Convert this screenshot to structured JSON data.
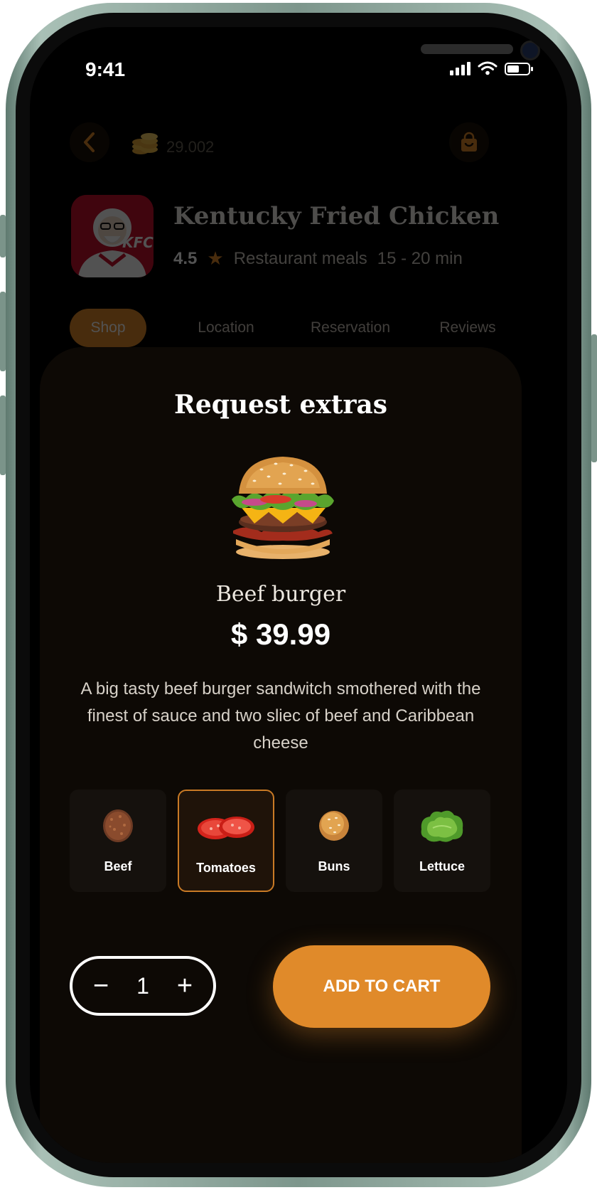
{
  "status_bar": {
    "time": "9:41"
  },
  "header": {
    "back_icon": "chevron-left-icon",
    "coins_icon": "coins-icon",
    "coins_value": "29.002",
    "bag_icon": "shopping-bag-icon"
  },
  "restaurant": {
    "name": "Kentucky Fried Chicken",
    "rating": "4.5",
    "category": "Restaurant meals",
    "delivery_time": "15 - 20 min",
    "logo_text": "KFC"
  },
  "tabs": [
    {
      "label": "Shop",
      "active": true
    },
    {
      "label": "Location",
      "active": false
    },
    {
      "label": "Reservation",
      "active": false
    },
    {
      "label": "Reviews",
      "active": false
    }
  ],
  "sheet": {
    "title": "Request extras",
    "product_name": "Beef burger",
    "price": "$ 39.99",
    "description": "A big tasty beef burger sandwitch smothered with the finest of sauce and two sliec of beef and Caribbean cheese",
    "extras": [
      {
        "label": "Beef",
        "icon": "beef-patty-icon",
        "selected": false
      },
      {
        "label": "Tomatoes",
        "icon": "tomato-slices-icon",
        "selected": true
      },
      {
        "label": "Buns",
        "icon": "bun-icon",
        "selected": false
      },
      {
        "label": "Lettuce",
        "icon": "lettuce-icon",
        "selected": false
      }
    ],
    "quantity": "1",
    "add_to_cart_label": "ADD TO CART"
  },
  "colors": {
    "accent": "#e08a2a",
    "sheet_background": "#0d0905",
    "screen_background": "#000000"
  }
}
